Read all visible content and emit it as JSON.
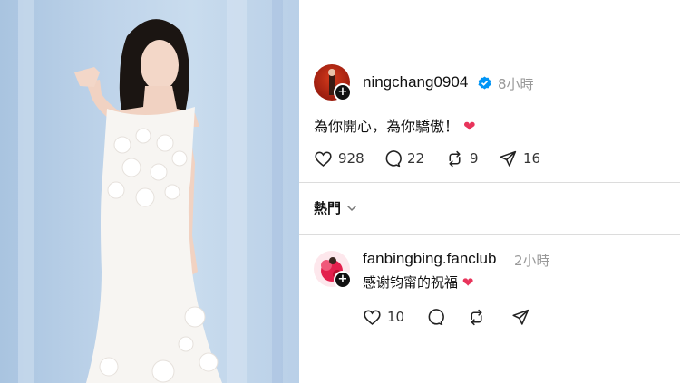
{
  "post": {
    "username": "ningchang0904",
    "time": "8小時",
    "text": "為你開心，為你驕傲！",
    "emoji": "❤",
    "likes": "928",
    "comments": "22",
    "reposts": "9",
    "shares": "16"
  },
  "sort": {
    "label": "熱門"
  },
  "reply": {
    "username": "fanbingbing.fanclub",
    "time": "2小時",
    "text": "感谢钧甯的祝福",
    "emoji": "❤",
    "likes": "10"
  },
  "colors": {
    "accent_heart": "#e8345b",
    "verified_blue": "#0095f6"
  },
  "icons": [
    "heart-icon",
    "comment-icon",
    "repost-icon",
    "share-icon",
    "verified-badge-icon",
    "chevron-down-icon",
    "plus-icon"
  ]
}
